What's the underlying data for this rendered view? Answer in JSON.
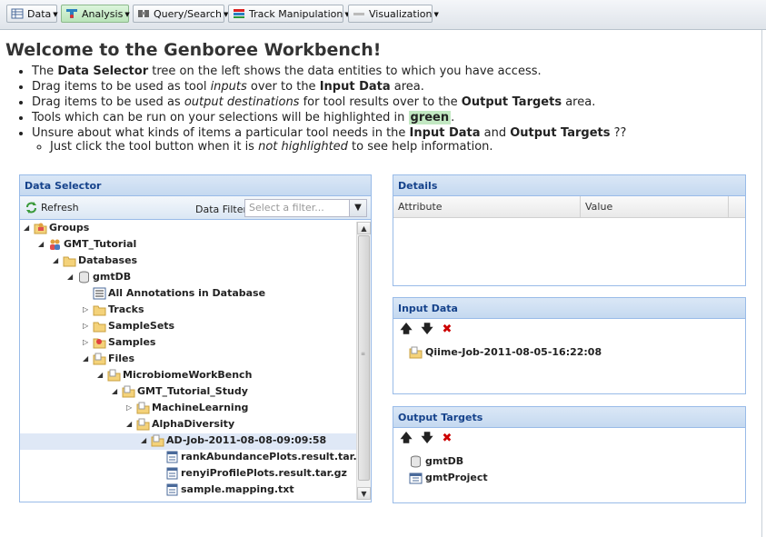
{
  "toolbar": {
    "menus": [
      {
        "label": "Data",
        "icon": "data-icon"
      },
      {
        "label": "Analysis",
        "icon": "analysis-icon"
      },
      {
        "label": "Query/Search",
        "icon": "query-icon"
      },
      {
        "label": "Track Manipulation",
        "icon": "track-icon"
      },
      {
        "label": "Visualization",
        "icon": "visualization-icon"
      }
    ]
  },
  "welcome": {
    "title": "Welcome to the Genboree Workbench!",
    "b1_pre": "The ",
    "b1_bold": "Data Selector",
    "b1_post": " tree on the left shows the data entities to which you have access.",
    "b2_pre": "Drag items to be used as tool ",
    "b2_em": "inputs",
    "b2_mid": " over to the ",
    "b2_bold": "Input Data",
    "b2_post": " area.",
    "b3_pre": "Drag items to be used as ",
    "b3_em": "output destinations",
    "b3_mid": " for tool results over to the ",
    "b3_bold": "Output Targets",
    "b3_post": " area.",
    "b4_pre": "Tools which can be run on your selections will be highlighted in ",
    "b4_green": "green",
    "b4_post": ".",
    "b5_pre": "Unsure about what kinds of items a particular tool needs in the ",
    "b5_bold1": "Input Data",
    "b5_mid": " and ",
    "b5_bold2": "Output Targets",
    "b5_post": " ??",
    "sub_pre": "Just click the tool button when it is ",
    "sub_em": "not highlighted",
    "sub_post": " to see help information."
  },
  "data_selector": {
    "title": "Data Selector",
    "refresh_label": "Refresh",
    "filter_label": "Data Filter:",
    "filter_placeholder": "Select a filter...",
    "selected_row": "AD-Job-2011-08-08-09:09:58",
    "tree": [
      {
        "label": "Groups",
        "icon": "group-folder-icon",
        "toggle": "expanded"
      },
      {
        "label": "GMT_Tutorial",
        "icon": "group-icon",
        "toggle": "expanded"
      },
      {
        "label": "Databases",
        "icon": "folder-icon",
        "toggle": "expanded"
      },
      {
        "label": "gmtDB",
        "icon": "database-icon",
        "toggle": "expanded"
      },
      {
        "label": "All Annotations in Database",
        "icon": "annotations-icon",
        "toggle": "none"
      },
      {
        "label": "Tracks",
        "icon": "folder-icon",
        "toggle": "collapsed"
      },
      {
        "label": "SampleSets",
        "icon": "folder-icon",
        "toggle": "collapsed"
      },
      {
        "label": "Samples",
        "icon": "samples-folder-icon",
        "toggle": "collapsed"
      },
      {
        "label": "Files",
        "icon": "files-folder-icon",
        "toggle": "expanded"
      },
      {
        "label": "MicrobiomeWorkBench",
        "icon": "files-folder-icon",
        "toggle": "expanded"
      },
      {
        "label": "GMT_Tutorial_Study",
        "icon": "files-folder-icon",
        "toggle": "expanded"
      },
      {
        "label": "MachineLearning",
        "icon": "files-folder-icon",
        "toggle": "collapsed"
      },
      {
        "label": "AlphaDiversity",
        "icon": "files-folder-icon",
        "toggle": "expanded"
      },
      {
        "label": "AD-Job-2011-08-08-09:09:58",
        "icon": "files-folder-icon",
        "toggle": "expanded"
      },
      {
        "label": "rankAbundancePlots.result.tar.gz",
        "icon": "file-icon",
        "toggle": "none"
      },
      {
        "label": "renyiProfilePlots.result.tar.gz",
        "icon": "file-icon",
        "toggle": "none"
      },
      {
        "label": "sample.mapping.txt",
        "icon": "file-icon",
        "toggle": "none"
      }
    ]
  },
  "details": {
    "title": "Details",
    "col_attribute": "Attribute",
    "col_value": "Value"
  },
  "input_data": {
    "title": "Input Data",
    "items": [
      {
        "label": "Qiime-Job-2011-08-05-16:22:08",
        "icon": "files-folder-icon"
      }
    ]
  },
  "output_targets": {
    "title": "Output Targets",
    "items": [
      {
        "label": "gmtDB",
        "icon": "database-icon"
      },
      {
        "label": "gmtProject",
        "icon": "project-icon"
      }
    ]
  },
  "colors": {
    "panel_border": "#99bbe8",
    "panel_title": "#15428b",
    "highlight_green": "#c2e8c2",
    "selected_row": "#dfe8f6",
    "remove_red": "#cc0000"
  }
}
